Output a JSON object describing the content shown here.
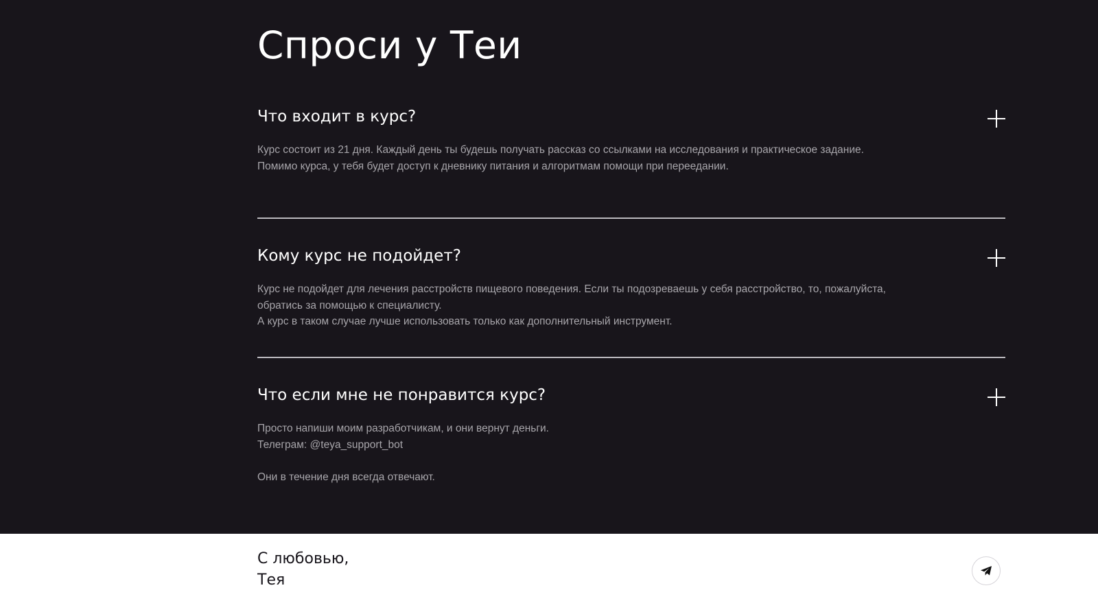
{
  "page": {
    "title": "Спроси у Теи",
    "colors": {
      "dark_bg": "#18151b",
      "text": "#ffffff",
      "muted": "#a8a6ab",
      "divider": "#bdbbc0"
    }
  },
  "faq": [
    {
      "question": "Что входит в курс?",
      "answer_lines": [
        "Курс состоит из 21 дня. Каждый день ты будешь получать рассказ со ссылками на исследования и практическое задание.",
        "Помимо курса, у тебя будет доступ к дневнику питания и алгоритмам помощи при переедании."
      ],
      "toggle_icon": "plus-icon"
    },
    {
      "question": "Кому курс не подойдет?",
      "answer_lines": [
        "Курс не подойдет для лечения расстройств пищевого поведения. Если ты подозреваешь у себя расстройство, то, пожалуйста,",
        "обратись за помощью к специалисту.",
        "А курс в таком случае лучше использовать только как дополнительный инструмент."
      ],
      "toggle_icon": "plus-icon"
    },
    {
      "question": "Что если мне не понравится курс?",
      "answer_lines": [
        "Просто напиши моим разработчикам, и они вернут деньги.",
        "Телеграм: @teya_support_bot",
        "",
        "Они в течение дня всегда отвечают."
      ],
      "toggle_icon": "plus-icon"
    }
  ],
  "footer": {
    "line1": "С любовью,",
    "line2": "Тея",
    "telegram_icon": "telegram-icon"
  }
}
